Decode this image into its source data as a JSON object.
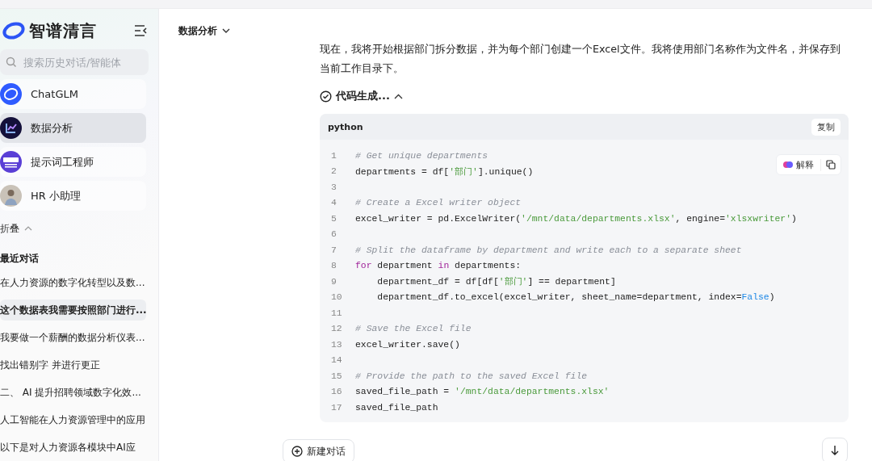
{
  "sidebar": {
    "logo": "智谱清言",
    "search": {
      "placeholder": "搜索历史对话/智能体"
    },
    "agents": [
      {
        "name": "ChatGLM",
        "kind": "glm",
        "selected": false
      },
      {
        "name": "数据分析",
        "kind": "chart",
        "selected": true
      },
      {
        "name": "提示词工程师",
        "kind": "prompt",
        "selected": false
      },
      {
        "name": "HR 小助理",
        "kind": "person",
        "selected": false
      }
    ],
    "collapse": "折叠",
    "recent_heading": "最近对话",
    "conversations": [
      {
        "title": "在人力资源的数字化转型以及数...",
        "selected": false
      },
      {
        "title": "这个数据表我需要按照部门进行...",
        "selected": true
      },
      {
        "title": "我要做一个薪酬的数据分析仪表...",
        "selected": false
      },
      {
        "title": "找出错别字 并进行更正",
        "selected": false
      },
      {
        "title": "二、 AI 提升招聘领域数字化效...",
        "selected": false
      },
      {
        "title": "人工智能在人力资源管理中的应用",
        "selected": false
      },
      {
        "title": "以下是对人力资源各模块中AI应",
        "selected": false
      }
    ]
  },
  "header": {
    "agent": "数据分析"
  },
  "message": {
    "text": "现在，我将开始根据部门拆分数据，并为每个部门创建一个Excel文件。我将使用部门名称作为文件名，并保存到当前工作目录下。",
    "status": "代码生成...",
    "expanded": true,
    "code": {
      "language": "python",
      "copy": "复制",
      "explain": "解释",
      "lines": [
        {
          "number": "1",
          "segments": [
            {
              "kind": "comment",
              "text": "# Get unique departments"
            }
          ]
        },
        {
          "number": "2",
          "segments": [
            {
              "kind": "plain",
              "text": "departments = df["
            },
            {
              "kind": "string",
              "text": "'部门'"
            },
            {
              "kind": "plain",
              "text": "].unique()"
            }
          ]
        },
        {
          "number": "3"
        },
        {
          "number": "4",
          "segments": [
            {
              "kind": "comment",
              "text": "# Create a Excel writer object"
            }
          ]
        },
        {
          "number": "5",
          "segments": [
            {
              "kind": "plain",
              "text": "excel_writer = pd.ExcelWriter("
            },
            {
              "kind": "string",
              "text": "'/mnt/data/departments.xlsx'"
            },
            {
              "kind": "plain",
              "text": ", engine="
            },
            {
              "kind": "string",
              "text": "'xlsxwriter'"
            },
            {
              "kind": "plain",
              "text": ")"
            }
          ]
        },
        {
          "number": "6"
        },
        {
          "number": "7",
          "segments": [
            {
              "kind": "comment",
              "text": "# Split the dataframe by department and write each to a separate sheet"
            }
          ]
        },
        {
          "number": "8",
          "segments": [
            {
              "kind": "keyword",
              "text": "for"
            },
            {
              "kind": "plain",
              "text": " department "
            },
            {
              "kind": "keyword",
              "text": "in"
            },
            {
              "kind": "plain",
              "text": " departments:"
            }
          ]
        },
        {
          "number": "9",
          "segments": [
            {
              "kind": "plain",
              "text": "    department_df = df[df["
            },
            {
              "kind": "string",
              "text": "'部门'"
            },
            {
              "kind": "plain",
              "text": "] == department]"
            }
          ]
        },
        {
          "number": "10",
          "segments": [
            {
              "kind": "plain",
              "text": "    department_df.to_excel(excel_writer, sheet_name=department, index="
            },
            {
              "kind": "bool",
              "text": "False"
            },
            {
              "kind": "plain",
              "text": ")"
            }
          ]
        },
        {
          "number": "11"
        },
        {
          "number": "12",
          "segments": [
            {
              "kind": "comment",
              "text": "# Save the Excel file"
            }
          ]
        },
        {
          "number": "13",
          "segments": [
            {
              "kind": "plain",
              "text": "excel_writer.save()"
            }
          ]
        },
        {
          "number": "14"
        },
        {
          "number": "15",
          "segments": [
            {
              "kind": "comment",
              "text": "# Provide the path to the saved Excel file"
            }
          ]
        },
        {
          "number": "16",
          "segments": [
            {
              "kind": "plain",
              "text": "saved_file_path = "
            },
            {
              "kind": "string",
              "text": "'/mnt/data/departments.xlsx'"
            }
          ]
        },
        {
          "number": "17",
          "segments": [
            {
              "kind": "plain",
              "text": "saved_file_path"
            }
          ]
        }
      ]
    }
  },
  "new_chat": "新建对话"
}
